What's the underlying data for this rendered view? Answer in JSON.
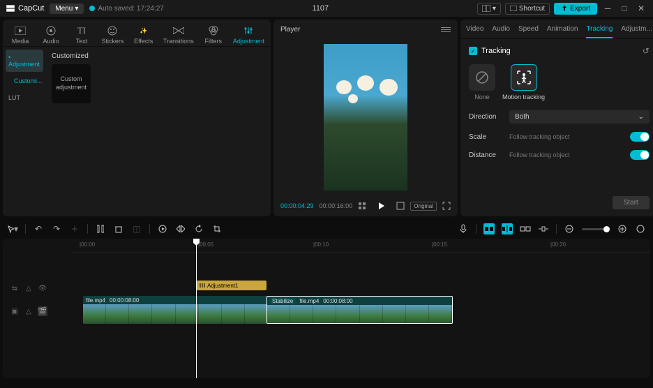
{
  "titlebar": {
    "app_name": "CapCut",
    "menu_label": "Menu",
    "autosave": "Auto saved: 17:24:27",
    "project_name": "1107",
    "shortcut_label": "Shortcut",
    "export_label": "Export"
  },
  "asset_tabs": {
    "media": "Media",
    "audio": "Audio",
    "text": "Text",
    "stickers": "Stickers",
    "effects": "Effects",
    "transitions": "Transitions",
    "filters": "Filters",
    "adjustment": "Adjustment"
  },
  "sidebar": {
    "adjustment": "Adjustment",
    "customi": "Customi...",
    "lut": "LUT"
  },
  "left_content": {
    "customized": "Customized",
    "thumb_label": "Custom adjustment"
  },
  "player": {
    "title": "Player",
    "current_time": "00:00:04:29",
    "duration": "00:00:16:00",
    "original": "Original"
  },
  "prop_tabs": {
    "video": "Video",
    "audio": "Audio",
    "speed": "Speed",
    "animation": "Animation",
    "tracking": "Tracking",
    "adjustment": "Adjustm..."
  },
  "tracking": {
    "section": "Tracking",
    "none": "None",
    "motion": "Motion tracking",
    "direction_label": "Direction",
    "direction_value": "Both",
    "scale_label": "Scale",
    "scale_sub": "Follow tracking object",
    "distance_label": "Distance",
    "distance_sub": "Follow tracking object",
    "start": "Start"
  },
  "timeline": {
    "ticks": [
      "|00:00",
      "|00:05",
      "|00:10",
      "|00:15",
      "|00:20"
    ],
    "adjust_clip": "Adjustment1",
    "clip1_name": "file.mp4",
    "clip1_dur": "00:00:08:00",
    "clip2_badge": "Stabilize",
    "clip2_name": "file.mp4",
    "clip2_dur": "00:00:08:00"
  }
}
